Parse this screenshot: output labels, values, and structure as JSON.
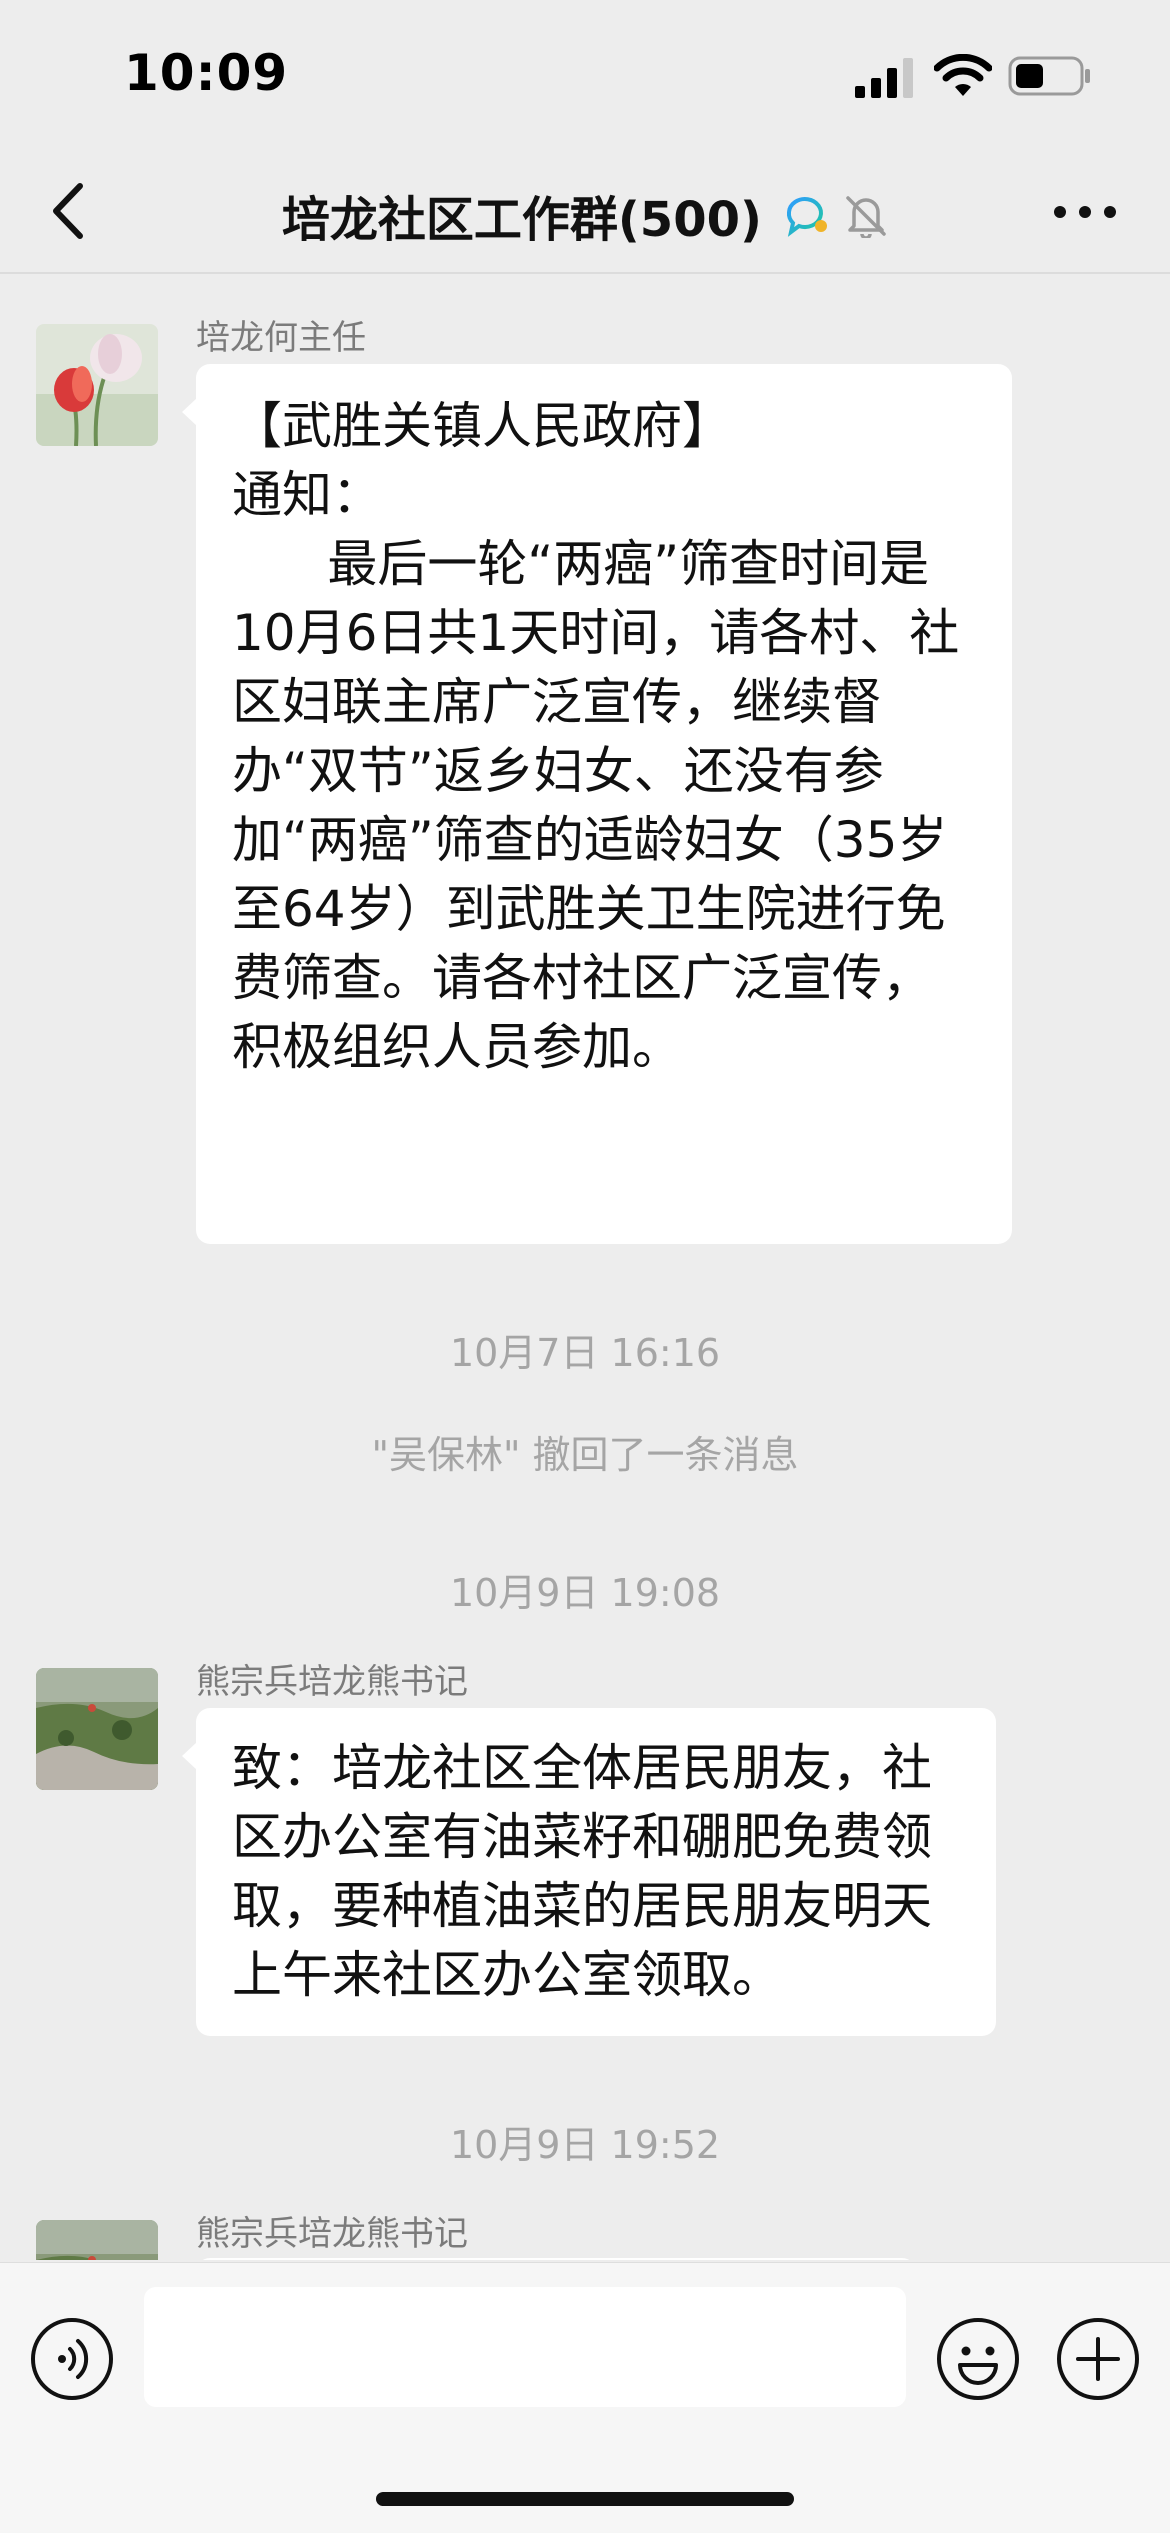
{
  "status_bar": {
    "time": "10:09",
    "battery_level": 0.45
  },
  "nav": {
    "title": "培龙社区工作群(500)",
    "icons": [
      "back-icon",
      "chat-search-icon",
      "mute-bell-icon",
      "more-icon"
    ]
  },
  "messages": [
    {
      "sender": "培龙何主任",
      "text": "【武胜关镇人民政府】\n通知：\n      最后一轮“两癌”筛查时间是10月6日共1天时间，请各村、社区妇联主席广泛宣传，继续督办“双节”返乡妇女、还没有参加“两癌”筛查的适龄妇女（35岁至64岁）到武胜关卫生院进行免费筛查。请各村社区广泛宣传，积极组织人员参加。"
    },
    {
      "sender": "熊宗兵培龙熊书记",
      "text": "致：培龙社区全体居民朋友，社区办公室有油菜籽和硼肥免费领取，要种植油菜的居民朋友明天上午来社区办公室领取。"
    },
    {
      "sender": "熊宗兵培龙熊书记",
      "text": ""
    }
  ],
  "system": {
    "time1": "10月7日 16:16",
    "recall": "\"吴保林\" 撤回了一条消息",
    "time2": "10月9日 19:08",
    "time3": "10月9日 19:52"
  },
  "input": {
    "value": "",
    "placeholder": ""
  },
  "colors": {
    "background": "#ededed",
    "bubble": "#ffffff",
    "system_text": "#a5a5a5"
  }
}
